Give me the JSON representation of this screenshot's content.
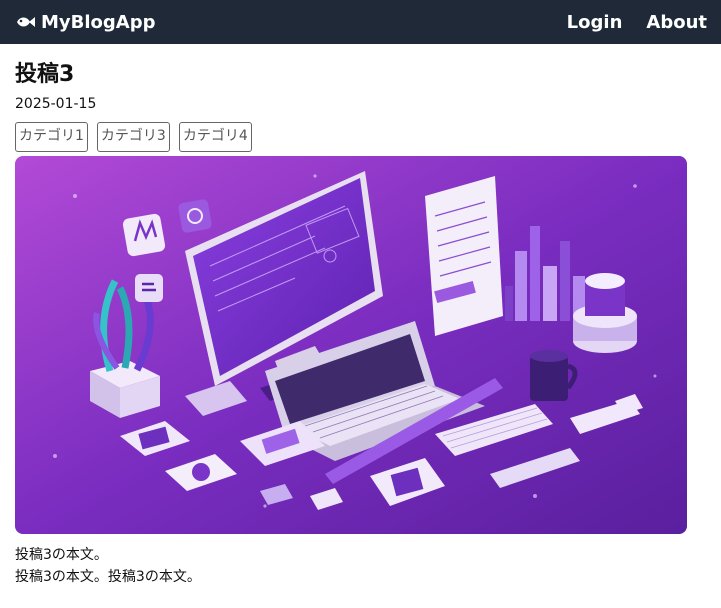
{
  "navbar": {
    "brand": "MyBlogApp",
    "brand_icon": "fish-icon",
    "links": [
      "Login",
      "About"
    ],
    "background": "#1f2937"
  },
  "post": {
    "title": "投稿3",
    "date": "2025-01-15",
    "categories": [
      "カテゴリ1",
      "カテゴリ3",
      "カテゴリ4"
    ],
    "image": "workspace-illustration",
    "body_lines": [
      "投稿3の本文。",
      "投稿3の本文。投稿3の本文。"
    ]
  },
  "colors": {
    "accent_purple": "#7b2fc9",
    "tag_border": "#666666"
  }
}
